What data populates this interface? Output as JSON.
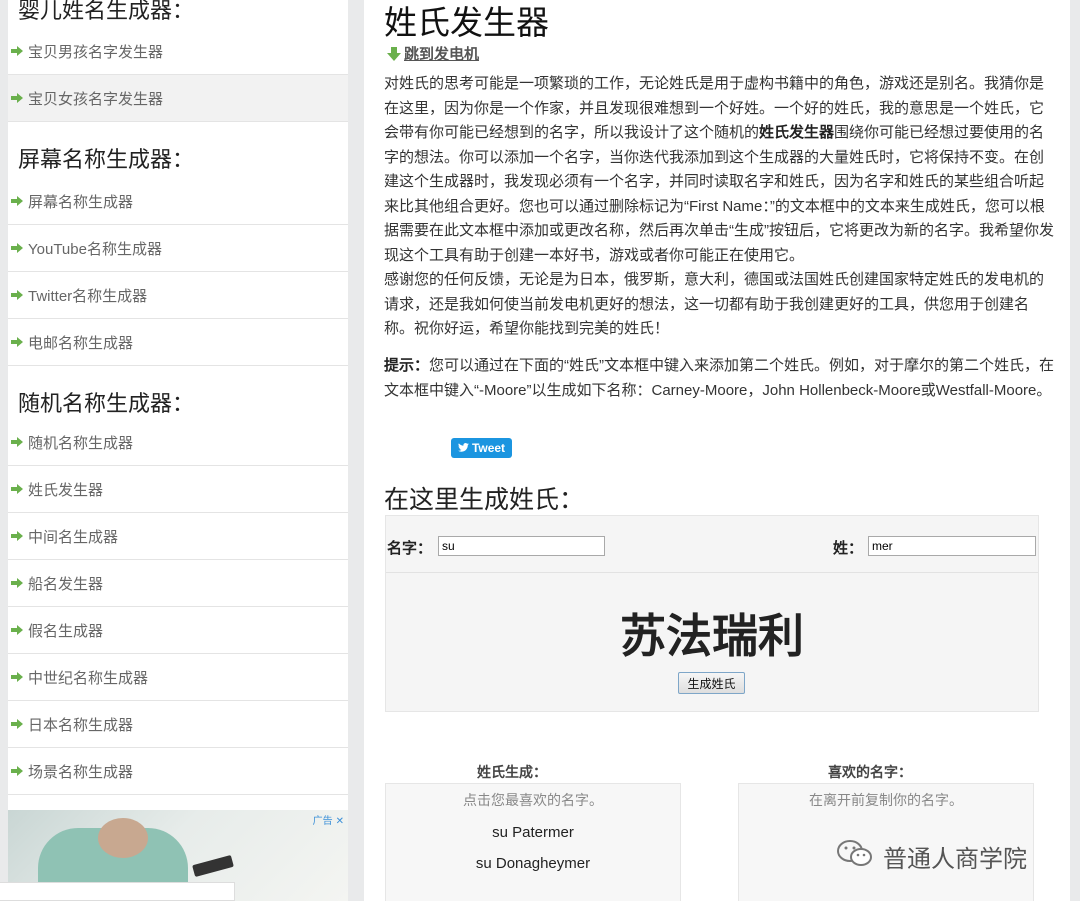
{
  "sidebar": {
    "sections": [
      {
        "title": "婴儿姓名生成器：",
        "items": [
          "宝贝男孩名字发生器",
          "宝贝女孩名字发生器"
        ]
      },
      {
        "title": "屏幕名称生成器：",
        "items": [
          "屏幕名称生成器",
          "YouTube名称生成器",
          "Twitter名称生成器",
          "电邮名称生成器"
        ]
      },
      {
        "title": "随机名称生成器：",
        "items": [
          "随机名称生成器",
          "姓氏发生器",
          "中间名生成器",
          "船名发生器",
          "假名生成器",
          "中世纪名称生成器",
          "日本名称生成器",
          "场景名称生成器"
        ]
      }
    ],
    "ad_tag": "广告",
    "ad_close": "✕"
  },
  "main": {
    "title": "姓氏发生器",
    "jump_link": "跳到发电机",
    "p1_a": "对姓氏的思考可能是一项繁琐的工作，无论姓氏是用于虚构书籍中的角色，游戏还是别名。我猜你是在这里，因为你是一个作家，并且发现很难想到一个好姓。一个好的姓氏，我的意思是一个姓氏，它会带有你可能已经想到的名字，所以我设计了这个随机的",
    "p1_bold": "姓氏发生器",
    "p1_b": "围绕你可能已经想过要使用的名字的想法。你可以添加一个名字，当你迭代我添加到这个生成器的大量姓氏时，它将保持不变。在创建这个生成器时，我发现必须有一个名字，并同时读取名字和姓氏，因为名字和姓氏的某些组合听起来比其他组合更好。您也可以通过删除标记为“First Name：”的文本框中的文本来生成姓氏，您可以根据需要在此文本框中添加或更改名称，然后再次单击“生成”按钮后，它将更改为新的名字。我希望你发现这个工具有助于创建一本好书，游戏或者你可能正在使用它。",
    "p2": "感谢您的任何反馈，无论是为日本，俄罗斯，意大利，德国或法国姓氏创建国家特定姓氏的发电机的请求，还是我如何使当前发电机更好的想法，这一切都有助于我创建更好的工具，供您用于创建名称。祝你好运，希望你能找到完美的姓氏！",
    "p3_bold": "提示：",
    "p3": "您可以通过在下面的“姓氏”文本框中键入来添加第二个姓氏。例如，对于摩尔的第二个姓氏，在文本框中键入“-Moore”以生成如下名称：Carney-Moore，John Hollenbeck-Moore或Westfall-Moore。",
    "tweet_label": "Tweet",
    "generate_heading": "在这里生成姓氏：",
    "first_name_label": "名字：",
    "first_name_value": "su",
    "last_name_label": "姓：",
    "last_name_value": "mer",
    "result_name": "苏法瑞利",
    "generate_button": "生成姓氏",
    "generated_title": "姓氏生成：",
    "generated_hint": "点击您最喜欢的名字。",
    "generated_names": [
      "su Patermer",
      "su Donagheymer"
    ],
    "favorites_title": "喜欢的名字：",
    "favorites_hint": "在离开前复制你的名字。"
  },
  "watermark": "普通人商学院",
  "colors": {
    "arrow_green": "#6ab04c",
    "tweet_blue": "#1b95e0",
    "ad_tag_blue": "#3a8fd8"
  }
}
